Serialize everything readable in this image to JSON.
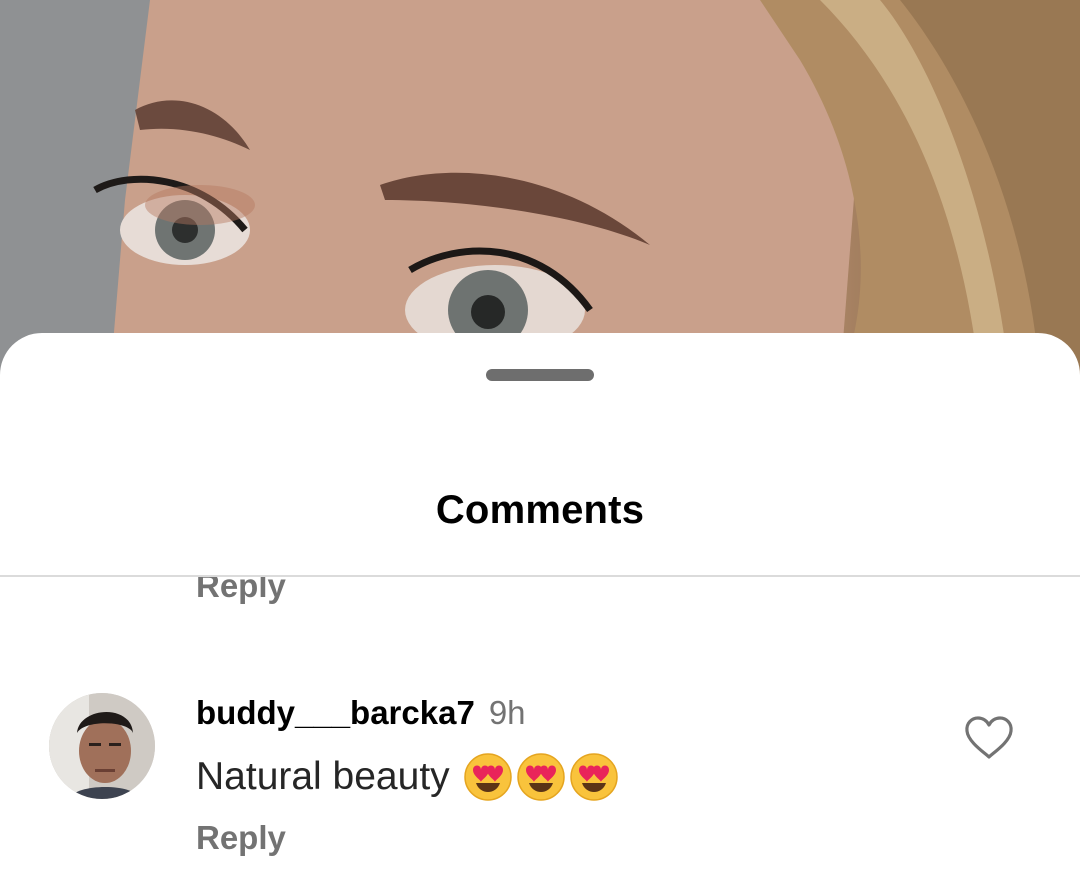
{
  "comments_sheet": {
    "title": "Comments",
    "previous_reply_label": "Reply"
  },
  "comments": [
    {
      "username": "buddy___barcka7",
      "time": "9h",
      "text": "Natural beauty",
      "emoji": [
        "smiling-face-with-heart-eyes",
        "smiling-face-with-heart-eyes",
        "smiling-face-with-heart-eyes"
      ],
      "reply_label": "Reply",
      "like_icon": "heart-outline-icon"
    }
  ],
  "colors": {
    "sheet_background": "#ffffff",
    "primary_text": "#000000",
    "secondary_text": "#737373",
    "divider": "#dbdbdb",
    "handle": "#6e6e6e"
  }
}
